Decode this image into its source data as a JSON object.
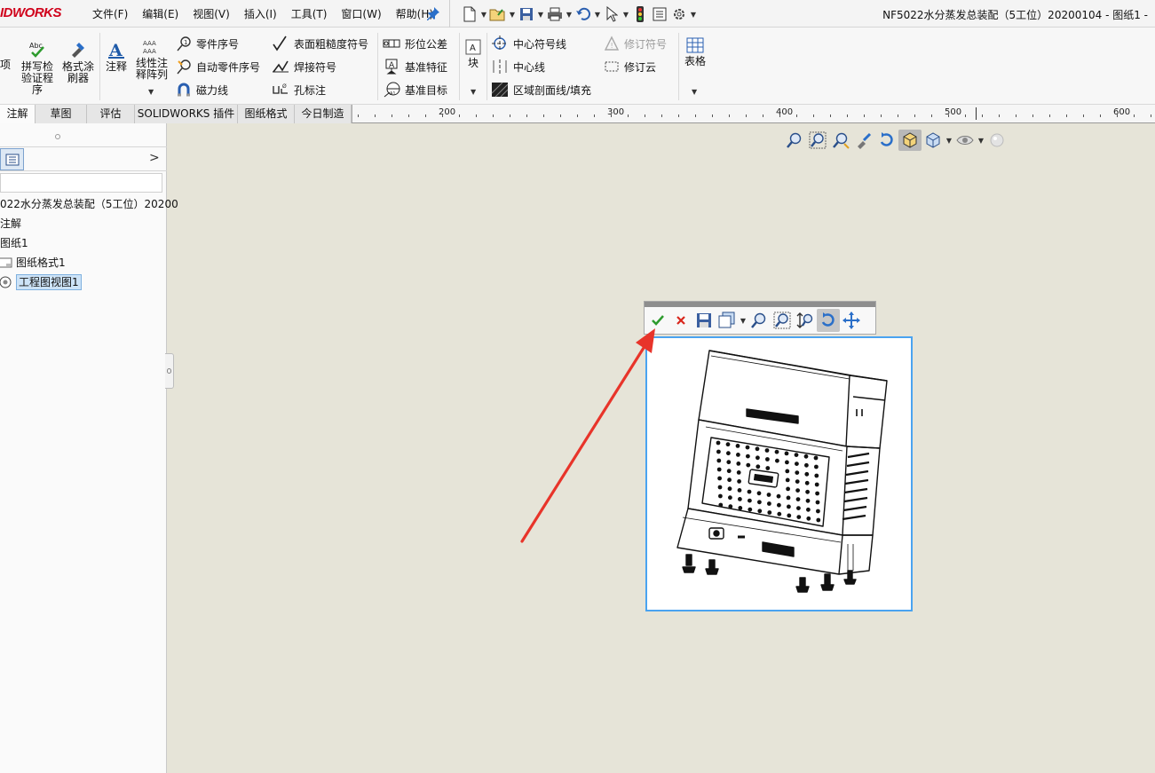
{
  "app": {
    "logo_text": "IDWORKS",
    "window_title": "NF5022水分蒸发总装配（5工位）20200104 - 图纸1 -"
  },
  "menu": [
    "文件(F)",
    "编辑(E)",
    "视图(V)",
    "插入(I)",
    "工具(T)",
    "窗口(W)",
    "帮助(H)"
  ],
  "ribbon": {
    "partial_label": "项",
    "spell_check_label": [
      "拼写检",
      "验证程序"
    ],
    "format_painter_label": [
      "格式涂",
      "刷器"
    ],
    "note_label": "注释",
    "linear_note_label": [
      "线性注",
      "释阵列"
    ],
    "balloon_label": "零件序号",
    "auto_balloon_label": "自动零件序号",
    "magnetic_line_label": "磁力线",
    "surface_finish_label": "表面粗糙度符号",
    "weld_symbol_label": "焊接符号",
    "hole_callout_label": "孔标注",
    "geometric_tolerance_label": "形位公差",
    "datum_feature_label": "基准特征",
    "datum_target_label": "基准目标",
    "block_label": "块",
    "center_mark_label": "中心符号线",
    "centerline_label": "中心线",
    "area_hatch_label": "区域剖面线/填充",
    "revision_symbol_label": "修订符号",
    "revision_cloud_label": "修订云",
    "table_label": "表格"
  },
  "tabs": [
    "注解",
    "草图",
    "评估",
    "SOLIDWORKS 插件",
    "图纸格式",
    "今日制造"
  ],
  "ruler": {
    "labels": [
      "200",
      "300",
      "400",
      "500",
      "600"
    ]
  },
  "tree": {
    "root": "022水分蒸发总装配（5工位）20200",
    "annotations": "注解",
    "sheet": "图纸1",
    "sheet_format": "图纸格式1",
    "drawing_view": "工程图视图1"
  },
  "icons": {
    "hud": [
      "zoom-to-fit-icon",
      "zoom-to-area-icon",
      "zoom-selection-icon",
      "pan-icon",
      "rotate-icon",
      "display-style-icon",
      "view-orientation-icon",
      "hide-show-icon",
      "appearance-icon"
    ],
    "view_toolbar": [
      "ok-check-icon",
      "cancel-x-icon",
      "save-icon",
      "view-orientation-icon",
      "zoom-to-fit-icon",
      "zoom-to-area-icon",
      "zoom-in-out-icon",
      "rotate-view-icon",
      "pan-icon"
    ]
  },
  "colors": {
    "canvas": "#e6e4d8",
    "view_frame": "#4aa3f0",
    "arrow": "#e8342a",
    "logo": "#d0021b"
  }
}
